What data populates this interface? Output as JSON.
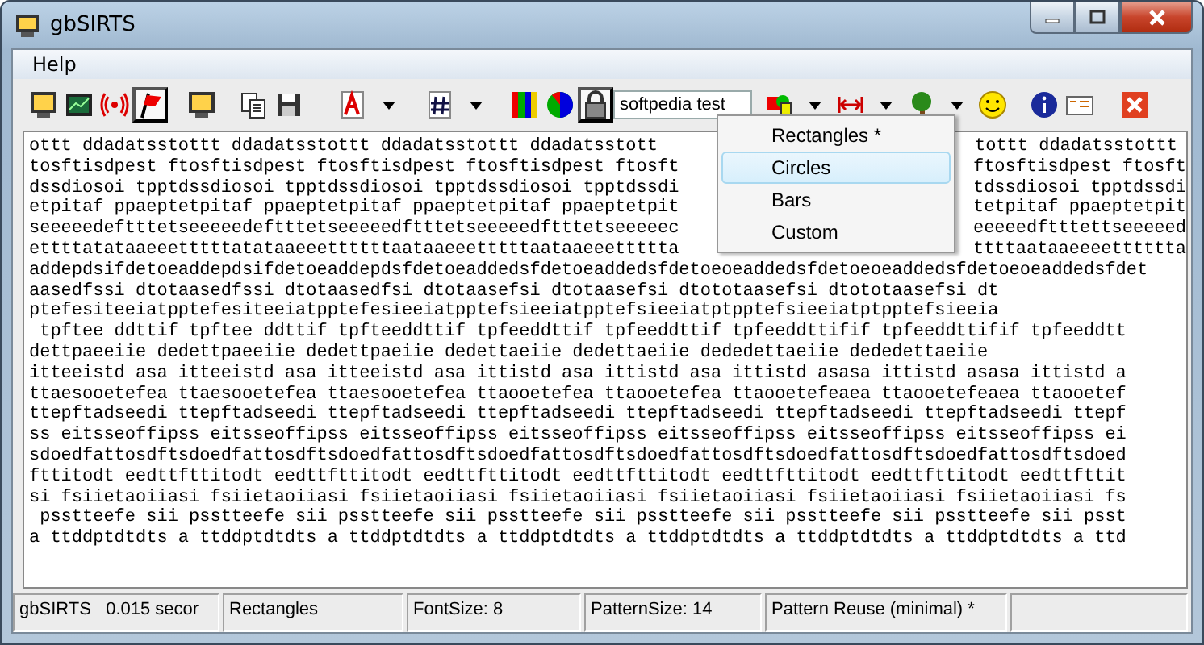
{
  "window": {
    "title": "gbSIRTS"
  },
  "menu_bar": [
    {
      "label": "Help"
    }
  ],
  "toolbar": {
    "buttons": [
      {
        "pressed": false
      },
      {
        "pressed": false
      },
      {
        "pressed": false
      },
      {
        "pressed": true
      },
      {
        "pressed": false
      },
      {
        "pressed": false
      },
      {
        "pressed": false
      },
      {
        "pressed": false
      },
      {
        "pressed": false
      },
      {
        "pressed": false
      },
      {
        "pressed": false
      },
      {
        "pressed": false
      },
      {
        "pressed": false
      },
      {
        "pressed": true
      },
      {
        "pressed": false
      },
      {
        "pressed": false
      },
      {
        "pressed": false
      },
      {
        "pressed": false
      },
      {
        "pressed": false
      },
      {
        "pressed": false
      },
      {
        "pressed": false
      },
      {
        "pressed": false
      },
      {
        "pressed": false
      },
      {
        "pressed": false
      }
    ],
    "text_field": {
      "value": "softpedia test"
    }
  },
  "shape_menu": {
    "open": true,
    "items": [
      {
        "label": "Rectangles *",
        "selected": false
      },
      {
        "label": "Circles",
        "selected": true
      },
      {
        "label": "Bars",
        "selected": false
      },
      {
        "label": "Custom",
        "selected": false
      }
    ]
  },
  "text_lines": [
    {
      "left": "ottt ddadatsstottt ddadatsstottt ddadatsstottt ddadatsstott",
      "right": "tottt ddadatsstottt"
    },
    {
      "left": "tosftisdpest ftosftisdpest ftosftisdpest ftosftisdpest ftosft",
      "right": "ftosftisdpest ftosft"
    },
    {
      "left": "dssdiosoi tpptdssdiosoi tpptdssdiosoi tpptdssdiosoi tpptdssdi",
      "right": "tdssdiosoi tpptdssdi"
    },
    {
      "left": "etpitaf ppaeptetpitaf ppaeptetpitaf ppaeptetpitaf ppaeptetpit",
      "right": "tetpitaf ppaeptetpit"
    },
    {
      "left": "seeeeedeftttetseeeeedeftttetseeeeedftttetseeeeedftttetseeeeec",
      "right": "eeeeedftttettseeeeed"
    },
    {
      "left": "ettttatataaeeetttttatataaeeettttttaataaeeetttttaataaeeettttta",
      "right": "ttttaataaeeeetttttta"
    },
    {
      "left": "addepdsifdetoeaddepdsifdetoeaddepdsfdetoeaddedsfdetoeaddedsfdetoeoeaddedsfdetoeoeaddedsfdetoeoeaddedsfdet"
    },
    {
      "left": "aasedfssi dtotaasedfssi dtotaasedfsi dtotaasefsi dtotaasefsi dtototaasefsi dtototaasefsi dt"
    },
    {
      "left": "ptefesiteeiatpptefesiteeiatpptefesieeiatpptefsieeiatpptefsieeiatptpptefsieeiatptpptefsieeia"
    },
    {
      "left": " tpftee ddttif tpftee ddttif tpfteeddttif tpfeeddttif tpfeeddttif tpfeeddttifif tpfeeddttifif tpfeeddtt"
    },
    {
      "left": "dettpaeeiie dedettpaeeiie dedettpaeiie dedettaeiie dedettaeiie dededettaeiie dededettaeiie"
    },
    {
      "left": "itteeistd asa itteeistd asa itteeistd asa ittistd asa ittistd asa ittistd asasa ittistd asasa ittistd a"
    },
    {
      "left": "ttaesooetefea ttaesooetefea ttaesooetefea ttaooetefea ttaooetefea ttaooetefeaea ttaooetefeaea ttaooetef"
    },
    {
      "left": "ttepftadseedi ttepftadseedi ttepftadseedi ttepftadseedi ttepftadseedi ttepftadseedi ttepftadseedi ttepf"
    },
    {
      "left": "ss eitsseoffipss eitsseoffipss eitsseoffipss eitsseoffipss eitsseoffipss eitsseoffipss eitsseoffipss ei"
    },
    {
      "left": "sdoedfattosdftsdoedfattosdftsdoedfattosdftsdoedfattosdftsdoedfattosdftsdoedfattosdftsdoedfattosdftsdoed"
    },
    {
      "left": "fttitodt eedttfttitodt eedttfttitodt eedttfttitodt eedttfttitodt eedttfttitodt eedttfttitodt eedttfttit"
    },
    {
      "left": "si fsiietaoiiasi fsiietaoiiasi fsiietaoiiasi fsiietaoiiasi fsiietaoiiasi fsiietaoiiasi fsiietaoiiasi fs"
    },
    {
      "left": " psstteefe sii psstteefe sii psstteefe sii psstteefe sii psstteefe sii psstteefe sii psstteefe sii psst"
    },
    {
      "left": "a ttddptdtdts a ttddptdtdts a ttddptdtdts a ttddptdtdts a ttddptdtdts a ttddptdtdts a ttddptdtdts a ttd"
    }
  ],
  "status_bar": [
    "gbSIRTS   0.015 secor",
    "Rectangles",
    "FontSize: 8",
    "PatternSize: 14",
    "Pattern Reuse (minimal) *"
  ]
}
